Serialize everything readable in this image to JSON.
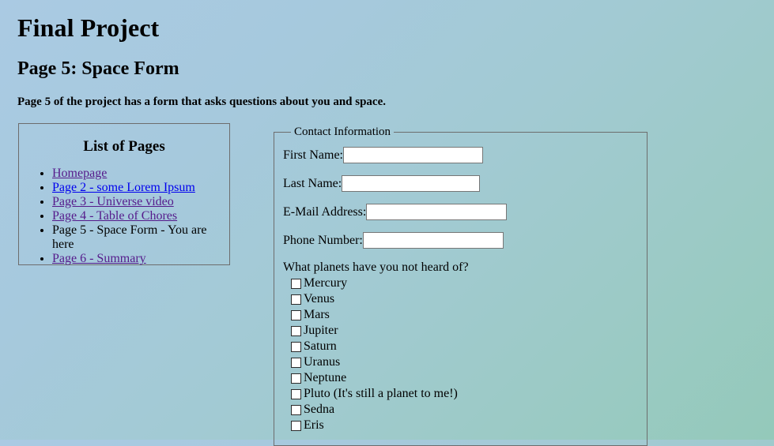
{
  "document": {
    "title": "Final Project",
    "section_heading": "Page 5: Space Form",
    "intro": "Page 5 of the project has a form that asks questions about you and space."
  },
  "nav": {
    "heading": "List of Pages",
    "items": [
      {
        "label": "Homepage",
        "state": "visited"
      },
      {
        "label": "Page 2 - some Lorem Ipsum",
        "state": "unvisited"
      },
      {
        "label": "Page 3 - Universe video",
        "state": "visited"
      },
      {
        "label": "Page 4 - Table of Chores",
        "state": "visited"
      },
      {
        "label": "Page 5 - Space Form - You are here",
        "state": "current"
      },
      {
        "label": "Page 6 - Summary",
        "state": "visited"
      }
    ]
  },
  "form": {
    "legend": "Contact Information",
    "fields": [
      {
        "label": "First Name:",
        "value": "",
        "placeholder": ""
      },
      {
        "label": "Last Name:",
        "value": "",
        "placeholder": ""
      },
      {
        "label": "E-Mail Address:",
        "value": "",
        "placeholder": ""
      },
      {
        "label": "Phone Number:",
        "value": "",
        "placeholder": ""
      }
    ],
    "question": "What planets have you not heard of?",
    "checkboxes": [
      {
        "label": "Mercury",
        "checked": false
      },
      {
        "label": "Venus",
        "checked": false
      },
      {
        "label": "Mars",
        "checked": false
      },
      {
        "label": "Jupiter",
        "checked": false
      },
      {
        "label": "Saturn",
        "checked": false
      },
      {
        "label": "Uranus",
        "checked": false
      },
      {
        "label": "Neptune",
        "checked": false
      },
      {
        "label": "Pluto (It's still a planet to me!)",
        "checked": false
      },
      {
        "label": "Sedna",
        "checked": false
      },
      {
        "label": "Eris",
        "checked": false
      }
    ]
  },
  "colors": {
    "background_start": "#aacae3",
    "background_end": "#94c9ba",
    "link_visited": "#551a8b",
    "link_unvisited": "#0000ee",
    "border": "#6d6d6d",
    "input_background": "#ffffff"
  }
}
